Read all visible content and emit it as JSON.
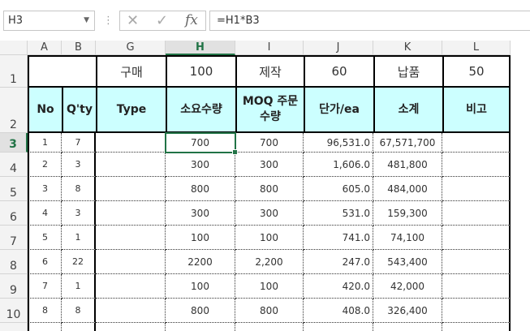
{
  "formula_bar": {
    "name_box": "H3",
    "formula": "=H1*B3",
    "dots": "⋮",
    "cancel_glyph": "✕",
    "enter_glyph": "✓",
    "fx_label": "fx"
  },
  "columns": [
    "A",
    "B",
    "G",
    "H",
    "I",
    "J",
    "K",
    "L"
  ],
  "active_column": "H",
  "active_row": "3",
  "row_numbers": [
    "1",
    "2",
    "3",
    "4",
    "5",
    "6",
    "7",
    "8",
    "9",
    "10"
  ],
  "row1": {
    "G": "구매",
    "H": "100",
    "I": "제작",
    "J": "60",
    "K": "납품",
    "L": "50"
  },
  "row2": {
    "A": "No",
    "B": "Q'ty",
    "G": "Type",
    "H": "소요수량",
    "I": "MOQ 주문 수량",
    "J": "단가/ea",
    "K": "소계",
    "L": "비고"
  },
  "table": [
    {
      "no": "1",
      "qty": "7",
      "req": "700",
      "moq": "700",
      "price": "96,531.0",
      "subtotal": "67,571,700"
    },
    {
      "no": "2",
      "qty": "3",
      "req": "300",
      "moq": "300",
      "price": "1,606.0",
      "subtotal": "481,800"
    },
    {
      "no": "3",
      "qty": "8",
      "req": "800",
      "moq": "800",
      "price": "605.0",
      "subtotal": "484,000"
    },
    {
      "no": "4",
      "qty": "3",
      "req": "300",
      "moq": "300",
      "price": "531.0",
      "subtotal": "159,300"
    },
    {
      "no": "5",
      "qty": "1",
      "req": "100",
      "moq": "100",
      "price": "741.0",
      "subtotal": "74,100"
    },
    {
      "no": "6",
      "qty": "22",
      "req": "2200",
      "moq": "2,200",
      "price": "247.0",
      "subtotal": "543,400"
    },
    {
      "no": "7",
      "qty": "1",
      "req": "100",
      "moq": "100",
      "price": "420.0",
      "subtotal": "42,000"
    },
    {
      "no": "8",
      "qty": "8",
      "req": "800",
      "moq": "800",
      "price": "408.0",
      "subtotal": "326,400"
    }
  ],
  "colors": {
    "header_fill": "#ccffff",
    "selection": "#217346"
  }
}
